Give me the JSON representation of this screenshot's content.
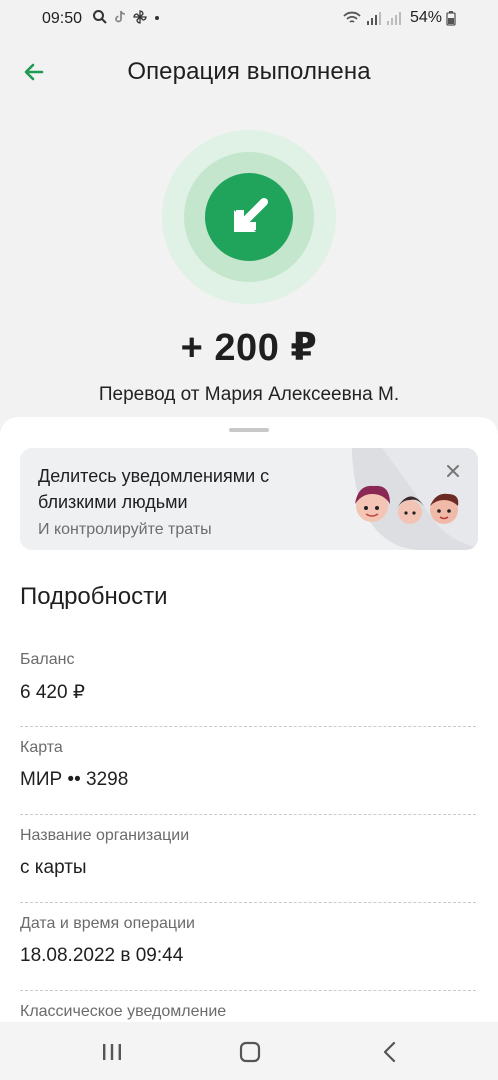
{
  "status_bar": {
    "time": "09:50",
    "battery": "54%",
    "icons_left": [
      "search-icon",
      "tiktok-icon",
      "pinwheel-icon",
      "dot-icon"
    ],
    "icons_right": [
      "wifi-icon",
      "signal-icon",
      "signal-icon",
      "battery-icon"
    ]
  },
  "header": {
    "title": "Операция выполнена",
    "back_icon": "arrow-left-icon"
  },
  "transaction": {
    "amount": "+ 200 ₽",
    "sender": "Перевод от Мария Алексеевна М.",
    "icon": "incoming-arrow-icon"
  },
  "promo": {
    "title": "Делитесь уведомлениями с близкими людьми",
    "subtitle": "И контролируйте траты"
  },
  "details": {
    "title": "Подробности",
    "rows": [
      {
        "label": "Баланс",
        "value": "6 420 ₽"
      },
      {
        "label": "Карта",
        "value": "МИР •• 3298"
      },
      {
        "label": "Название организации",
        "value": "с карты"
      },
      {
        "label": "Дата и время операции",
        "value": "18.08.2022 в 09:44"
      },
      {
        "label": "Классическое уведомление",
        "value": ""
      }
    ]
  },
  "colors": {
    "accent": "#20a35a",
    "background": "#f2f2f2"
  }
}
